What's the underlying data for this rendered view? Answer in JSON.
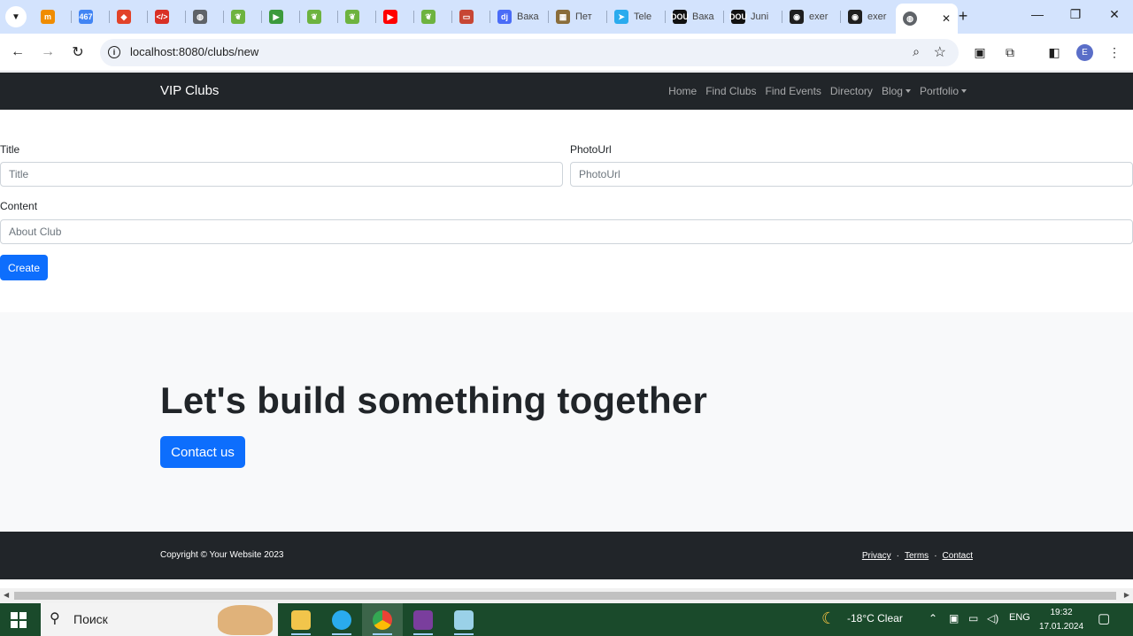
{
  "browser": {
    "tabs": [
      {
        "name": "tab-site-1",
        "label": "",
        "color": "#f08c00",
        "glyph": "m"
      },
      {
        "name": "tab-calendar",
        "label": "",
        "color": "#4285f4",
        "glyph": "467"
      },
      {
        "name": "tab-gitlab",
        "label": "",
        "color": "#e24329",
        "glyph": "◆"
      },
      {
        "name": "tab-devtools",
        "label": "",
        "color": "#d93025",
        "glyph": "</>"
      },
      {
        "name": "tab-globe",
        "label": "",
        "color": "#5f6368",
        "glyph": "◍"
      },
      {
        "name": "tab-spring-1",
        "label": "",
        "color": "#6db33f",
        "glyph": "❦"
      },
      {
        "name": "tab-green",
        "label": "",
        "color": "#3c9a3c",
        "glyph": "▶"
      },
      {
        "name": "tab-spring-2",
        "label": "",
        "color": "#6db33f",
        "glyph": "❦"
      },
      {
        "name": "tab-spring-3",
        "label": "",
        "color": "#6db33f",
        "glyph": "❦"
      },
      {
        "name": "tab-youtube",
        "label": "",
        "color": "#ff0000",
        "glyph": "▶"
      },
      {
        "name": "tab-spring-4",
        "label": "",
        "color": "#6db33f",
        "glyph": "❦"
      },
      {
        "name": "tab-oracle",
        "label": "",
        "color": "#c74634",
        "glyph": "▭"
      },
      {
        "name": "tab-djinni",
        "label": "Вака",
        "color": "#4a6cf7",
        "glyph": "dj"
      },
      {
        "name": "tab-pet",
        "label": "Пет",
        "color": "#8a6d3b",
        "glyph": "▦"
      },
      {
        "name": "tab-telegram",
        "label": "Tele",
        "color": "#2aabee",
        "glyph": "➤"
      },
      {
        "name": "tab-dou-1",
        "label": "Вака",
        "color": "#111111",
        "glyph": "DOU"
      },
      {
        "name": "tab-dou-2",
        "label": "Juni",
        "color": "#111111",
        "glyph": "DOU"
      },
      {
        "name": "tab-github-1",
        "label": "exer",
        "color": "#1f1f1f",
        "glyph": "◉"
      },
      {
        "name": "tab-github-2",
        "label": "exer",
        "color": "#1f1f1f",
        "glyph": "◉"
      }
    ],
    "url": "localhost:8080/clubs/new"
  },
  "site": {
    "brand": "VIP Clubs",
    "nav": {
      "home": "Home",
      "find_clubs": "Find Clubs",
      "find_events": "Find Events",
      "directory": "Directory",
      "blog": "Blog",
      "portfolio": "Portfolio"
    },
    "form": {
      "title_label": "Title",
      "title_placeholder": "Title",
      "photo_label": "PhotoUrl",
      "photo_placeholder": "PhotoUrl",
      "content_label": "Content",
      "content_placeholder": "About Club",
      "submit": "Create"
    },
    "hero": {
      "heading": "Let's build something together",
      "button": "Contact us"
    },
    "footer": {
      "copyright": "Copyright © Your Website 2023",
      "privacy": "Privacy",
      "terms": "Terms",
      "contact": "Contact",
      "separator": "·"
    }
  },
  "taskbar": {
    "search_placeholder": "Поиск",
    "weather": "-18°C  Clear",
    "language": "ENG",
    "time": "19:32",
    "date": "17.01.2024"
  }
}
